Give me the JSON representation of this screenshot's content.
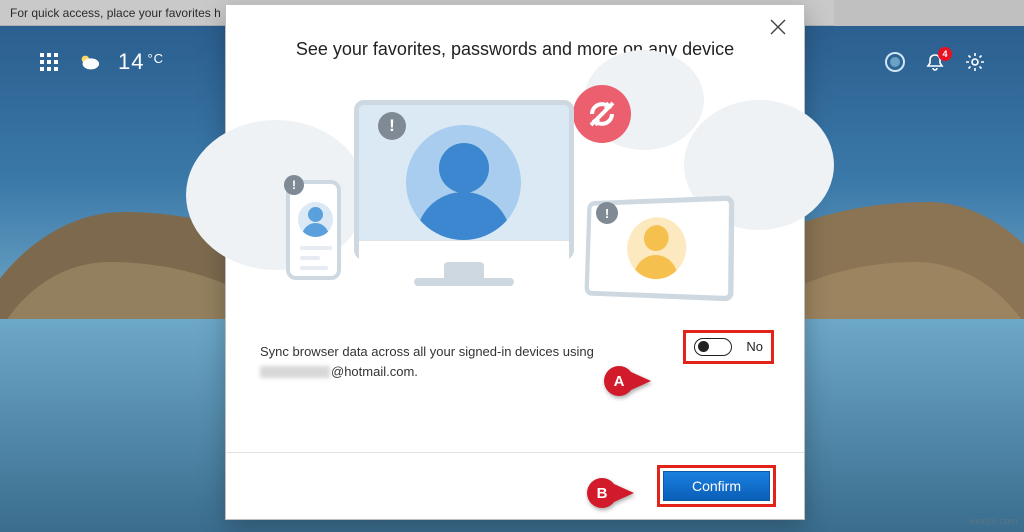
{
  "favorites_bar": {
    "hint": "For quick access, place your favorites h"
  },
  "ntp": {
    "temperature_value": "14",
    "temperature_unit": "°C",
    "notification_count": "4"
  },
  "dialog": {
    "title": "See your favorites, passwords and more on any device",
    "sync_text_prefix": "Sync browser data across all your signed-in devices using",
    "email_domain": "@hotmail.com.",
    "toggle_label": "No",
    "confirm_label": "Confirm"
  },
  "callouts": {
    "a": "A",
    "b": "B"
  },
  "watermark": "wsxdn.com"
}
